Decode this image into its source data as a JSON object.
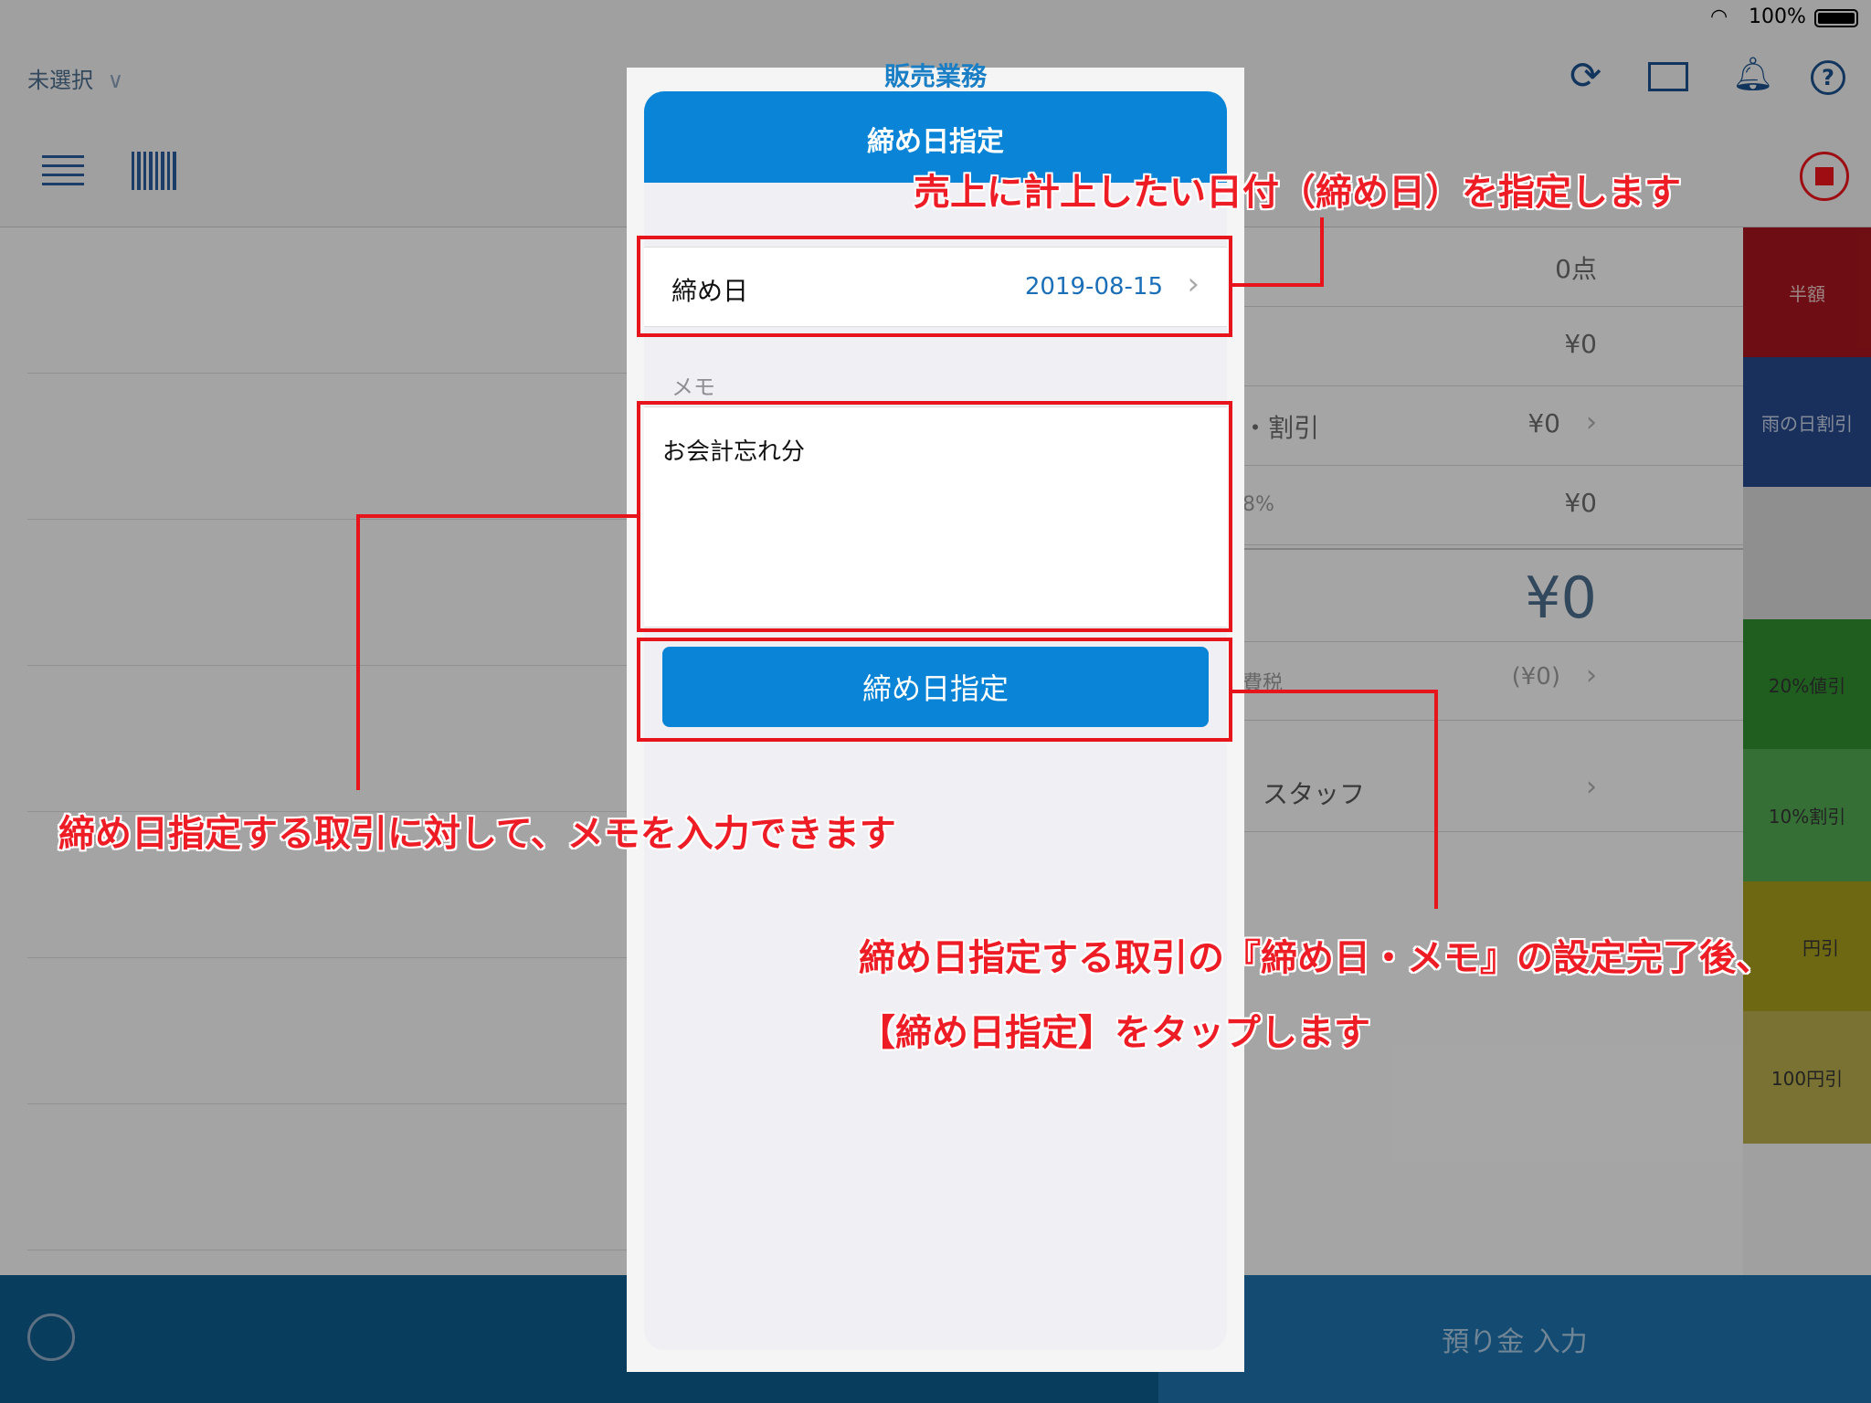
{
  "status": {
    "battery_text": "100%"
  },
  "topbar": {
    "selector_label": "未選択",
    "title": "販売業務"
  },
  "right_panel": {
    "count": "0点",
    "subtotal": "¥0",
    "discount_label": "・割引",
    "discount": "¥0",
    "tax_label": "8%",
    "tax": "¥0",
    "total": "¥0",
    "tax_incl_label": "費税",
    "tax_incl": "(¥0)",
    "staff_label": "スタッフ"
  },
  "tiles": [
    {
      "label": "半額",
      "color": "#a3141c"
    },
    {
      "label": "雨の日割引",
      "color": "#25478a"
    },
    {
      "label": "",
      "color": "#d3d3d3"
    },
    {
      "label": "20%値引",
      "color": "#2e8b2e"
    },
    {
      "label": "10%割引",
      "color": "#4fa44f"
    },
    {
      "label": "円引",
      "color": "#a49a1c"
    },
    {
      "label": "100円引",
      "color": "#b3a84a"
    }
  ],
  "bottombar": {
    "deposit_label": "預り金 入力"
  },
  "modal": {
    "title": "締め日指定",
    "date_label": "締め日",
    "date_value": "2019-08-15",
    "memo_label": "メモ",
    "memo_text": "お会計忘れ分",
    "button_label": "締め日指定"
  },
  "annotations": {
    "top": "売上に計上したい日付（締め日）を指定します",
    "memo": "締め日指定する取引に対して、メモを入力できます",
    "button_line1": "締め日指定する取引の『締め日・メモ』の設定完了後、",
    "button_line2": "【締め日指定】をタップします"
  },
  "colors": {
    "accent": "#0a84d6",
    "annotation": "#ee1c25"
  }
}
